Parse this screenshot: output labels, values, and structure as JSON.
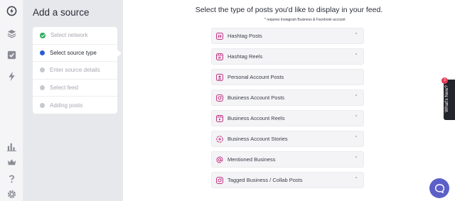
{
  "rail": {
    "icons": [
      "bolt-logo-icon",
      "layers-icon",
      "check-square-icon",
      "lightning-icon",
      "bar-chart-icon",
      "crown-icon",
      "help-icon",
      "gear-icon"
    ]
  },
  "steps": {
    "title": "Add a source",
    "items": [
      {
        "label": "Select network",
        "state": "done"
      },
      {
        "label": "Select source type",
        "state": "active"
      },
      {
        "label": "Enter source details",
        "state": "pending"
      },
      {
        "label": "Select feed",
        "state": "pending"
      },
      {
        "label": "Adding posts",
        "state": "pending"
      }
    ]
  },
  "main": {
    "title": "Select the type of posts you'd like to display in your feed.",
    "note": "* requires Instagram Business & Facebook account",
    "options": [
      {
        "label": "Hashtag Posts",
        "icon": "hashtag-icon",
        "star": "*"
      },
      {
        "label": "Hashtag Reels",
        "icon": "hashtag-reels-icon",
        "star": "*"
      },
      {
        "label": "Personal Account Posts",
        "icon": "person-icon",
        "star": ""
      },
      {
        "label": "Business Account Posts",
        "icon": "instagram-icon",
        "star": "*"
      },
      {
        "label": "Business Account Reels",
        "icon": "reels-icon",
        "star": "*"
      },
      {
        "label": "Business Account Stories",
        "icon": "stories-icon",
        "star": "*"
      },
      {
        "label": "Mentioned Business",
        "icon": "at-sign-icon",
        "star": "*"
      },
      {
        "label": "Tagged Business / Collab Posts",
        "icon": "instagram-icon",
        "star": "*"
      }
    ]
  },
  "whats_new": {
    "label": "What's New?",
    "badge": "3"
  },
  "colors": {
    "accent": "#5b5fc7",
    "done": "#2bab5c",
    "active": "#2d5bd6",
    "instagram": "#c13584"
  }
}
